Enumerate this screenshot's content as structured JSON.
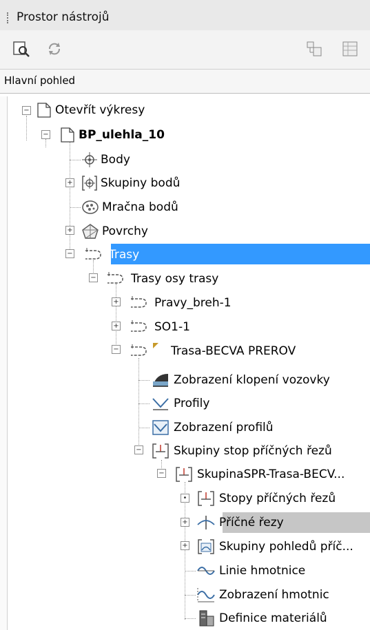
{
  "window": {
    "title": "Prostor nástrojů"
  },
  "toolbar": {
    "icons": [
      "preview-icon",
      "refresh-icon",
      "item-view-icon",
      "list-view-icon"
    ]
  },
  "view_selector": {
    "value": "Hlavní pohled"
  },
  "tree": {
    "open_drawings": "Otevřít výkresy",
    "drawing": "BP_ulehla_10",
    "points": "Body",
    "point_groups": "Skupiny bodů",
    "point_clouds": "Mračna bodů",
    "surfaces": "Povrchy",
    "alignments": "Trasy",
    "centerline_alignments": "Trasy osy trasy",
    "alignment_1": "Pravy_breh-1",
    "alignment_2": "SO1-1",
    "alignment_3": "Trasa-BECVA PREROV",
    "superelevation_views": "Zobrazení klopení vozovky",
    "profiles": "Profily",
    "profile_views": "Zobrazení profilů",
    "sample_line_groups": "Skupiny stop příčných řezů",
    "sample_line_group": "SkupinaSPR-Trasa-BECV...",
    "sample_lines": "Stopy příčných řezů",
    "sections": "Příčné řezy",
    "section_view_groups": "Skupiny pohledů příč...",
    "mass_haul_lines": "Linie hmotnice",
    "mass_haul_views": "Zobrazení hmotnic",
    "material_lists": "Definice materiálů"
  },
  "colors": {
    "selection": "#3399ff",
    "secondary_selection": "#c6c6c6"
  }
}
